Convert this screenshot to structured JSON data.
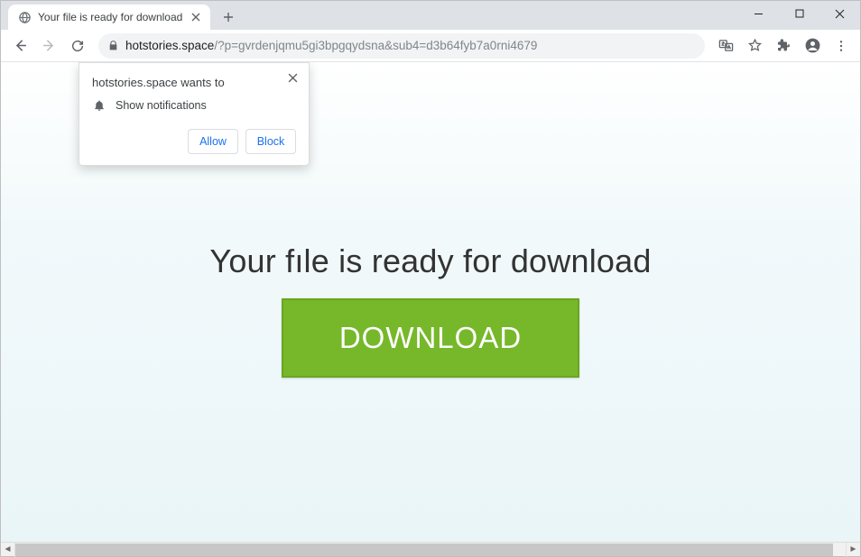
{
  "window": {
    "tab_title": "Your file is ready for download"
  },
  "address": {
    "host": "hotstories.space",
    "path": "/?p=gvrdenjqmu5gi3bpgqydsna&sub4=d3b64fyb7a0rni4679"
  },
  "page": {
    "heading": "Your fıle is ready for download",
    "download_label": "DOWNLOAD"
  },
  "permission": {
    "title": "hotstories.space wants to",
    "request_label": "Show notifications",
    "allow_label": "Allow",
    "block_label": "Block"
  }
}
